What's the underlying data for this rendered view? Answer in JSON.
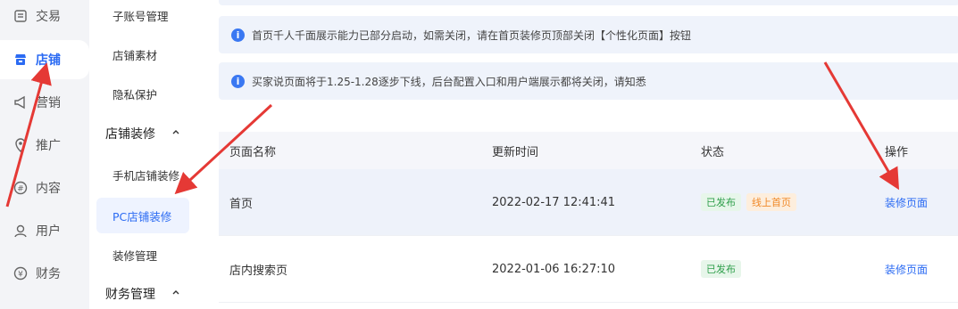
{
  "rail": {
    "items": [
      {
        "label": "交易",
        "icon": "trade-icon"
      },
      {
        "label": "店铺",
        "icon": "shop-icon"
      },
      {
        "label": "营销",
        "icon": "megaphone-icon"
      },
      {
        "label": "推广",
        "icon": "promote-icon"
      },
      {
        "label": "内容",
        "icon": "content-icon"
      },
      {
        "label": "用户",
        "icon": "user-icon"
      },
      {
        "label": "财务",
        "icon": "finance-icon"
      }
    ],
    "active_color": "#2b6bf3"
  },
  "submenu": {
    "items": {
      "sub_account": "子账号管理",
      "shop_material": "店铺素材",
      "privacy": "隐私保护",
      "mobile_decor": "手机店铺装修",
      "pc_decor": "PC店铺装修",
      "decor_manage": "装修管理"
    },
    "groups": {
      "shop_decor": "店铺装修",
      "finance_manage": "财务管理"
    }
  },
  "notices": [
    "首页千人千面展示能力已部分启动，如需关闭，请在首页装修页顶部关闭【个性化页面】按钮",
    "买家说页面将于1.25-1.28逐步下线，后台配置入口和用户端展示都将关闭，请知悉"
  ],
  "table": {
    "headers": [
      "页面名称",
      "更新时间",
      "状态",
      "操作"
    ],
    "rows": [
      {
        "name": "首页",
        "time": "2022-02-17 12:41:41",
        "status": "已发布",
        "tag": "线上首页",
        "action": "装修页面"
      },
      {
        "name": "店内搜索页",
        "time": "2022-01-06 16:27:10",
        "status": "已发布",
        "tag": "",
        "action": "装修页面"
      }
    ]
  },
  "colors": {
    "accent": "#2b6bf3",
    "annotation_arrow": "#e53935",
    "published_green": "#2e9e4a",
    "online_orange": "#f08a2a"
  }
}
